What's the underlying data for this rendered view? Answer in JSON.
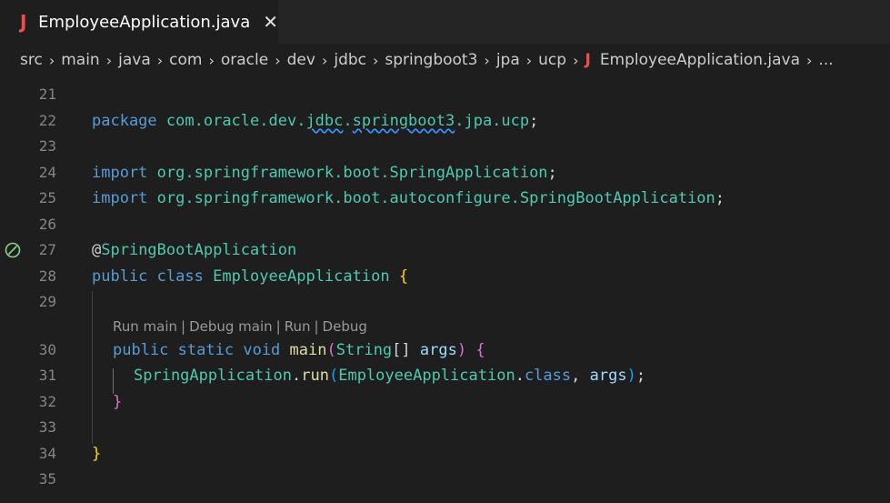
{
  "tab": {
    "icon": "J",
    "title": "EmployeeApplication.java",
    "close": "✕"
  },
  "breadcrumb": {
    "items": [
      "src",
      "main",
      "java",
      "com",
      "oracle",
      "dev",
      "jdbc",
      "springboot3",
      "jpa",
      "ucp"
    ],
    "file_icon": "J",
    "file": "EmployeeApplication.java",
    "more": "..."
  },
  "editor": {
    "line_numbers": [
      "21",
      "22",
      "23",
      "24",
      "25",
      "26",
      "27",
      "28",
      "29",
      "30",
      "31",
      "32",
      "33",
      "34",
      "35"
    ],
    "code": {
      "l22": {
        "kw": "package",
        "p1": "com.oracle.dev.",
        "p2": "jdbc",
        "p3": ".",
        "p4": "springboot3",
        "p5": ".jpa.ucp",
        "semi": ";"
      },
      "l24": {
        "kw": "import",
        "path": "org.springframework.boot.",
        "cls": "SpringApplication",
        "semi": ";"
      },
      "l25": {
        "kw": "import",
        "path": "org.springframework.boot.autoconfigure.",
        "cls": "SpringBootApplication",
        "semi": ";"
      },
      "l27": {
        "at": "@",
        "ann": "SpringBootApplication"
      },
      "l28": {
        "kw1": "public",
        "kw2": "class",
        "cls": "EmployeeApplication",
        "brace": "{"
      },
      "codelens": {
        "run_main": "Run main",
        "debug_main": "Debug main",
        "run": "Run",
        "debug": "Debug",
        "sep": "|"
      },
      "l30": {
        "kw1": "public",
        "kw2": "static",
        "kw3": "void",
        "fn": "main",
        "po": "(",
        "type": "String",
        "arr": "[]",
        "arg": "args",
        "pc": ")",
        "brace": "{"
      },
      "l31": {
        "cls": "SpringApplication",
        "dot": ".",
        "fn": "run",
        "po": "(",
        "cls2": "EmployeeApplication",
        "dot2": ".",
        "kwc": "class",
        "comma": ", ",
        "arg": "args",
        "pc": ")",
        "semi": ";"
      },
      "l32": {
        "brace": "}"
      },
      "l34": {
        "brace": "}"
      }
    }
  }
}
